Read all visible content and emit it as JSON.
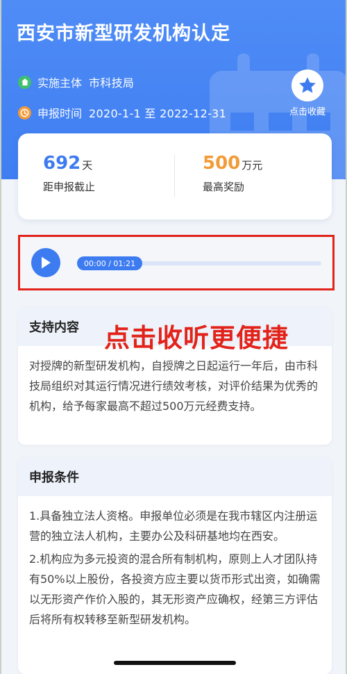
{
  "header": {
    "title": "西安市新型研发机构认定",
    "implementer_label": "实施主体",
    "implementer_value": "市科技局",
    "period_label": "申报时间",
    "period_value": "2020-1-1 至 2022-12-31",
    "favorite_label": "点击收藏"
  },
  "stats": {
    "days_value": "692",
    "days_unit": "天",
    "days_label": "距申报截止",
    "reward_value": "500",
    "reward_unit": "万元",
    "reward_label": "最高奖励"
  },
  "audio": {
    "time": "00:00 / 01:21",
    "progress": 0
  },
  "overlay": {
    "text": "点击收听更便捷"
  },
  "support": {
    "title": "支持内容",
    "body": "对授牌的新型研发机构，自授牌之日起运行一年后，由市科技局组织对其运行情况进行绩效考核，对评价结果为优秀的机构，给予每家最高不超过500万元经费支持。"
  },
  "conditions": {
    "title": "申报条件",
    "items": [
      "1.具备独立法人资格。申报单位必须是在我市辖区内注册运营的独立法人机构，主要办公及科研基地均在西安。",
      "2.机构应为多元投资的混合所有制机构，原则上人才团队持有50%以上股份，各投资方应主要以货币形式出资，如确需以无形资产作价入股的，其无形资产应确权，经第三方评估后将所有权转移至新型研发机构。"
    ]
  },
  "colors": {
    "primary": "#3d7bf0",
    "accent_orange": "#f29b38",
    "highlight_red": "#e2231a",
    "green": "#3fc06e"
  },
  "icons": {
    "implementer": "home-icon",
    "period": "clock-icon",
    "favorite": "star-icon",
    "play": "play-icon"
  }
}
